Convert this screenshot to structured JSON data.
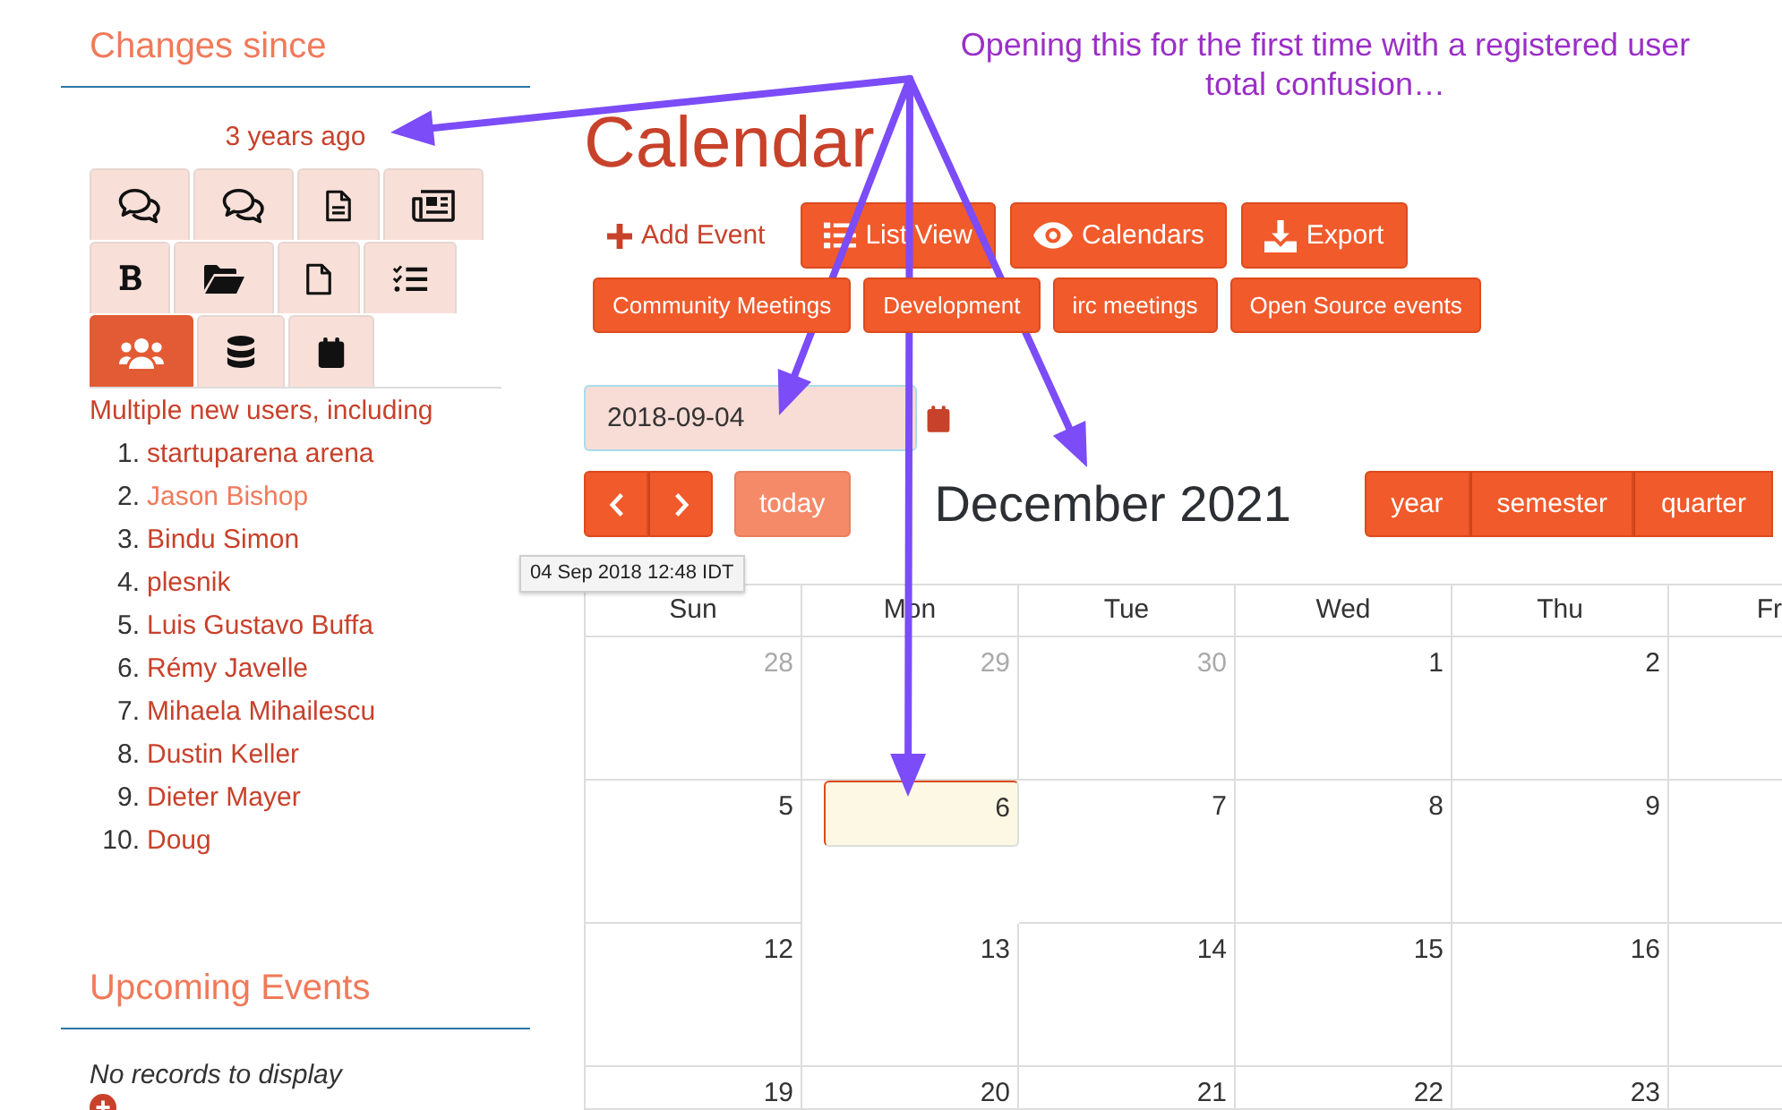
{
  "annotation": {
    "text": "Opening this for the first time with a registered user total confusion…"
  },
  "sidebar": {
    "changes": {
      "heading": "Changes since",
      "since": "3 years ago",
      "filters": [
        {
          "kind": "comments",
          "selected": false
        },
        {
          "kind": "forum",
          "selected": false
        },
        {
          "kind": "page",
          "selected": false
        },
        {
          "kind": "article",
          "selected": false
        },
        {
          "kind": "blog",
          "selected": false
        },
        {
          "kind": "folder",
          "selected": false
        },
        {
          "kind": "file",
          "selected": false
        },
        {
          "kind": "tasks",
          "selected": false
        },
        {
          "kind": "users",
          "selected": true
        },
        {
          "kind": "database",
          "selected": false
        },
        {
          "kind": "event",
          "selected": false
        }
      ],
      "summary": "Multiple new users, including",
      "users": [
        {
          "number": "1.",
          "name": "startuparena arena",
          "hovered": false
        },
        {
          "number": "2.",
          "name": "Jason Bishop",
          "hovered": true
        },
        {
          "number": "3.",
          "name": "Bindu Simon",
          "hovered": false
        },
        {
          "number": "4.",
          "name": "plesnik",
          "hovered": false
        },
        {
          "number": "5.",
          "name": "Luis Gustavo Buffa",
          "hovered": false
        },
        {
          "number": "6.",
          "name": "Rémy Javelle",
          "hovered": false
        },
        {
          "number": "7.",
          "name": "Mihaela Mihailescu",
          "hovered": false
        },
        {
          "number": "8.",
          "name": "Dustin Keller",
          "hovered": false
        },
        {
          "number": "9.",
          "name": "Dieter Mayer",
          "hovered": false
        },
        {
          "number": "10.",
          "name": "Doug",
          "hovered": false
        }
      ]
    },
    "upcoming": {
      "heading": "Upcoming Events",
      "empty_text": "No records to display"
    }
  },
  "tooltip": {
    "text": "04 Sep 2018 12:48 IDT"
  },
  "main": {
    "title": "Calendar",
    "toolbar": [
      {
        "kind": "add",
        "label": "Add Event"
      },
      {
        "kind": "list",
        "label": "List View"
      },
      {
        "kind": "calendars",
        "label": "Calendars"
      },
      {
        "kind": "export",
        "label": "Export"
      }
    ],
    "categories": [
      "Community Meetings",
      "Development",
      "irc meetings",
      "Open Source events"
    ],
    "date_field": {
      "value": "2018-09-04"
    },
    "nav": {
      "today": {
        "label": "today",
        "disabled": true
      },
      "title": "December 2021",
      "views": [
        {
          "label": "year",
          "selected": false
        },
        {
          "label": "semester",
          "selected": false
        },
        {
          "label": "quarter",
          "selected": false
        }
      ]
    },
    "calendar": {
      "weekdays": [
        "Sun",
        "Mon",
        "Tue",
        "Wed",
        "Thu",
        "Fr"
      ],
      "weeks": [
        {
          "days": [
            {
              "label": "28",
              "other_month": true,
              "today": false
            },
            {
              "label": "29",
              "other_month": true,
              "today": false
            },
            {
              "label": "30",
              "other_month": true,
              "today": false
            },
            {
              "label": "1",
              "other_month": false,
              "today": false
            },
            {
              "label": "2",
              "other_month": false,
              "today": false
            }
          ]
        },
        {
          "days": [
            {
              "label": "5",
              "other_month": false,
              "today": false
            },
            {
              "label": "6",
              "other_month": false,
              "today": true
            },
            {
              "label": "7",
              "other_month": false,
              "today": false
            },
            {
              "label": "8",
              "other_month": false,
              "today": false
            },
            {
              "label": "9",
              "other_month": false,
              "today": false
            }
          ]
        },
        {
          "days": [
            {
              "label": "12",
              "other_month": false,
              "today": false
            },
            {
              "label": "13",
              "other_month": false,
              "today": false
            },
            {
              "label": "14",
              "other_month": false,
              "today": false
            },
            {
              "label": "15",
              "other_month": false,
              "today": false
            },
            {
              "label": "16",
              "other_month": false,
              "today": false
            }
          ]
        },
        {
          "days": [
            {
              "label": "19",
              "other_month": false,
              "today": false
            },
            {
              "label": "20",
              "other_month": false,
              "today": false
            },
            {
              "label": "21",
              "other_month": false,
              "today": false
            },
            {
              "label": "22",
              "other_month": false,
              "today": false
            },
            {
              "label": "23",
              "other_month": false,
              "today": false
            }
          ]
        }
      ]
    }
  }
}
